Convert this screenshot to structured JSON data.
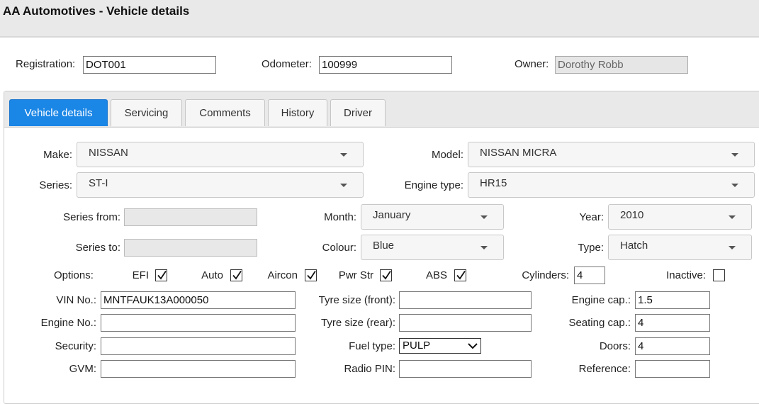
{
  "window": {
    "title": "AA Automotives - Vehicle details"
  },
  "header": {
    "registration_label": "Registration:",
    "registration_value": "DOT001",
    "odometer_label": "Odometer:",
    "odometer_value": "100999",
    "owner_label": "Owner:",
    "owner_value": "Dorothy Robb"
  },
  "tabs": [
    "Vehicle details",
    "Servicing",
    "Comments",
    "History",
    "Driver"
  ],
  "form": {
    "make": {
      "label": "Make:",
      "value": "NISSAN"
    },
    "model": {
      "label": "Model:",
      "value": "NISSAN MICRA"
    },
    "series": {
      "label": "Series:",
      "value": "ST-I"
    },
    "engine_type": {
      "label": "Engine type:",
      "value": "HR15"
    },
    "series_from": {
      "label": "Series from:",
      "value": ""
    },
    "month": {
      "label": "Month:",
      "value": "January"
    },
    "year": {
      "label": "Year:",
      "value": "2010"
    },
    "series_to": {
      "label": "Series to:",
      "value": ""
    },
    "colour": {
      "label": "Colour:",
      "value": "Blue"
    },
    "type": {
      "label": "Type:",
      "value": "Hatch"
    },
    "options_label": "Options:",
    "options": [
      {
        "label": "EFI",
        "checked": true
      },
      {
        "label": "Auto",
        "checked": true
      },
      {
        "label": "Aircon",
        "checked": true
      },
      {
        "label": "Pwr Str",
        "checked": true
      },
      {
        "label": "ABS",
        "checked": true
      }
    ],
    "cylinders": {
      "label": "Cylinders:",
      "value": "4"
    },
    "inactive": {
      "label": "Inactive:",
      "checked": false
    },
    "vin": {
      "label": "VIN No.:",
      "value": "MNTFAUK13A000050"
    },
    "tyre_front": {
      "label": "Tyre size (front):",
      "value": ""
    },
    "engine_cap": {
      "label": "Engine cap.:",
      "value": "1.5"
    },
    "engine_no": {
      "label": "Engine No.:",
      "value": ""
    },
    "tyre_rear": {
      "label": "Tyre size (rear):",
      "value": ""
    },
    "seating_cap": {
      "label": "Seating cap.:",
      "value": "4"
    },
    "security": {
      "label": "Security:",
      "value": ""
    },
    "fuel_type": {
      "label": "Fuel type:",
      "value": "PULP"
    },
    "doors": {
      "label": "Doors:",
      "value": "4"
    },
    "gvm": {
      "label": "GVM:",
      "value": ""
    },
    "radio_pin": {
      "label": "Radio PIN:",
      "value": ""
    },
    "reference": {
      "label": "Reference:",
      "value": ""
    }
  }
}
